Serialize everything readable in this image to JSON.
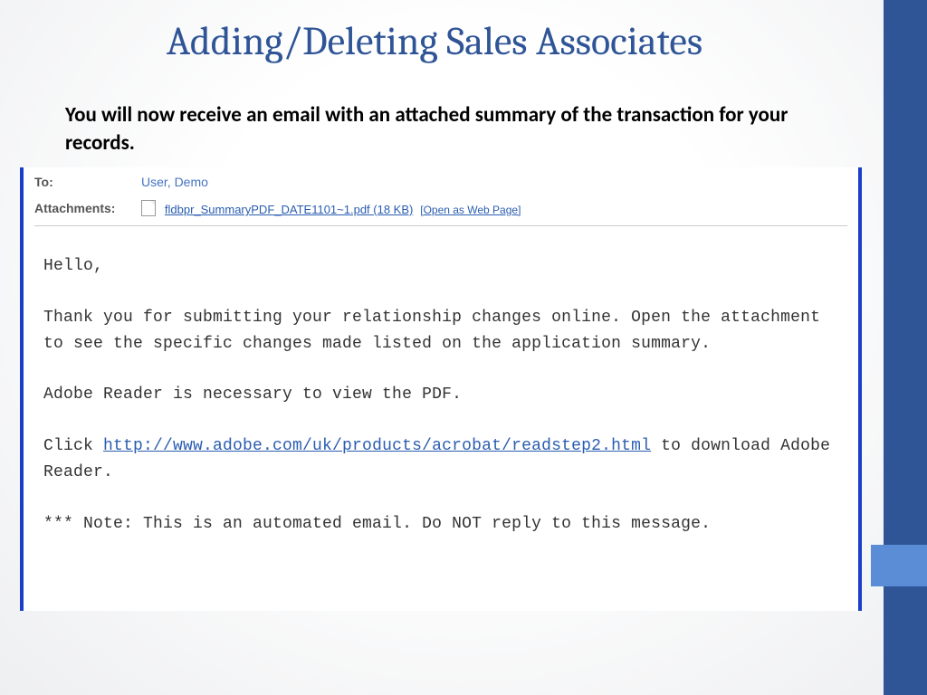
{
  "slide": {
    "title": "Adding/Deleting Sales Associates",
    "subtitle": "You will now receive an email with an attached summary of the transaction for your records."
  },
  "email": {
    "to_label": "To:",
    "to_value": "User, Demo",
    "attachments_label": "Attachments:",
    "attachment_filename": "fldbpr_SummaryPDF_DATE1101~1.pdf (18 KB)",
    "open_as_web": "[Open as Web Page]",
    "body": {
      "greeting": "Hello,",
      "para1": "Thank you for submitting your relationship changes online. Open the attachment to see the specific changes made listed on the application summary.",
      "para2": "Adobe Reader is necessary to view the PDF.",
      "para3_pre": "Click ",
      "para3_link": "http://www.adobe.com/uk/products/acrobat/readstep2.html",
      "para3_post": " to download Adobe Reader.",
      "note": "*** Note: This is an automated email. Do NOT reply to this message."
    }
  }
}
